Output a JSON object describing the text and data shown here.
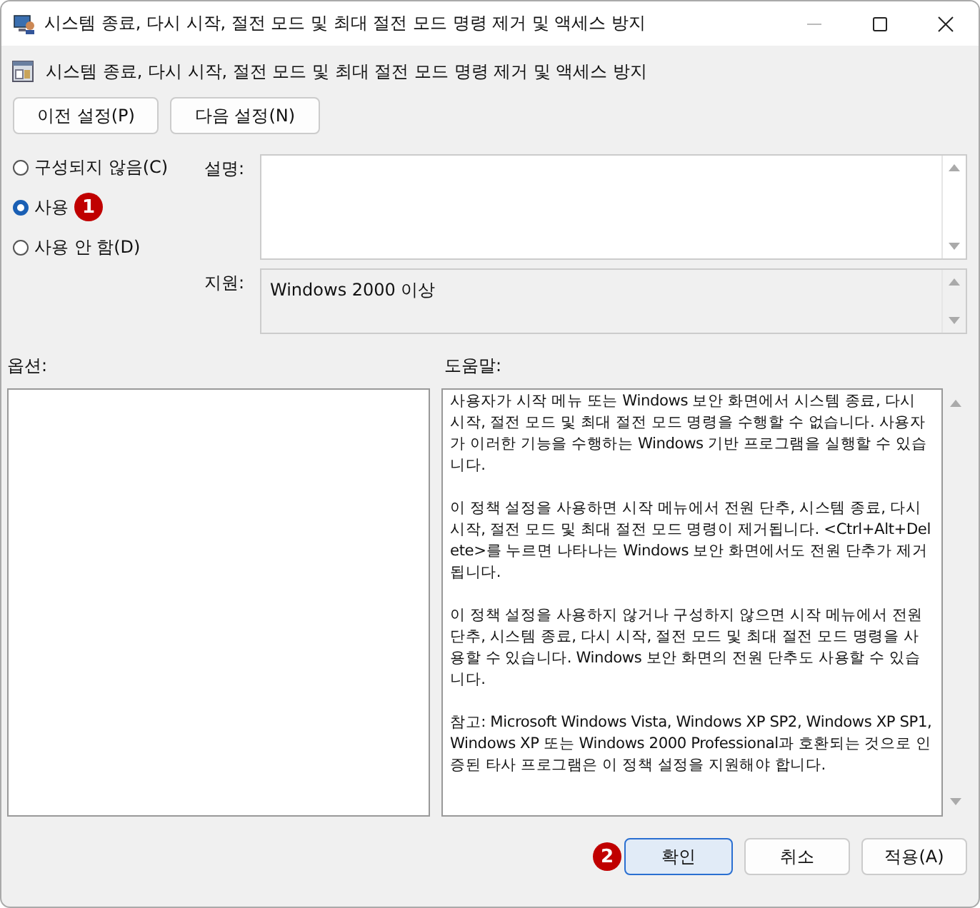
{
  "window": {
    "title": "시스템 종료, 다시 시작, 절전 모드 및 최대 절전 모드 명령 제거 및 액세스 방지"
  },
  "header": {
    "title": "시스템 종료, 다시 시작, 절전 모드 및 최대 절전 모드 명령 제거 및 액세스 방지"
  },
  "nav_buttons": [
    "이전 설정(P)",
    "다음 설정(N)"
  ],
  "radios": [
    {
      "label": "구성되지 않음(C)",
      "selected": false
    },
    {
      "label": "사용",
      "selected": true,
      "badge": "1"
    },
    {
      "label": "사용 안 함(D)",
      "selected": false
    }
  ],
  "comment": {
    "label": "설명:"
  },
  "supported": {
    "label": "지원:",
    "value": "Windows 2000 이상"
  },
  "options": {
    "label": "옵션:"
  },
  "help": {
    "label": "도움말:",
    "paragraphs": [
      "사용자가 시작 메뉴 또는 Windows 보안 화면에서 시스템 종료, 다시 시작, 절전 모드 및 최대 절전 모드 명령을 수행할 수 없습니다. 사용자가 이러한 기능을 수행하는 Windows 기반 프로그램을 실행할 수 있습니다.",
      "이 정책 설정을 사용하면 시작 메뉴에서 전원 단추, 시스템 종료, 다시 시작, 절전 모드 및 최대 절전 모드 명령이 제거됩니다. <Ctrl+Alt+Delete>를 누르면 나타나는 Windows 보안 화면에서도 전원 단추가 제거됩니다.",
      "이 정책 설정을 사용하지 않거나 구성하지 않으면 시작 메뉴에서 전원 단추, 시스템 종료, 다시 시작, 절전 모드 및 최대 절전 모드 명령을 사용할 수 있습니다. Windows 보안 화면의 전원 단추도 사용할 수 있습니다.",
      "참고: Microsoft Windows Vista, Windows XP SP2, Windows XP SP1, Windows XP 또는 Windows 2000 Professional과 호환되는 것으로 인증된 타사 프로그램은 이 정책 설정을 지원해야 합니다."
    ]
  },
  "footer_buttons": [
    {
      "label": "확인",
      "default": true,
      "badge": "2"
    },
    {
      "label": "취소",
      "default": false
    },
    {
      "label": "적용(A)",
      "default": false
    }
  ]
}
